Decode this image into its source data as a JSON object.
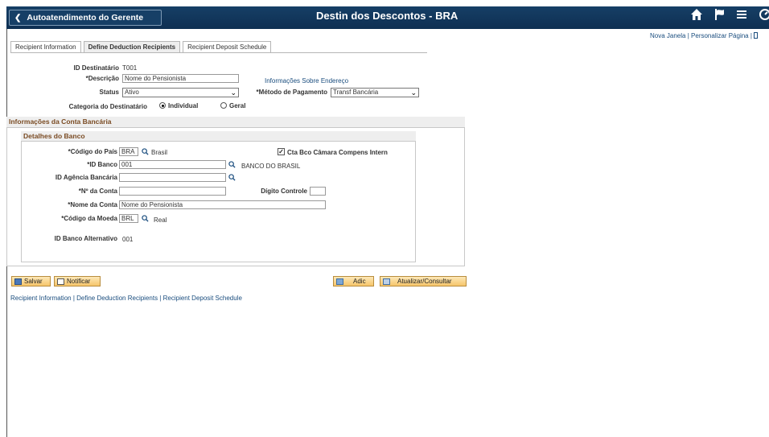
{
  "header": {
    "back_label": "Autoatendimento do Gerente",
    "title": "Destin dos Descontos - BRA",
    "icons": [
      "home-icon",
      "flag-icon",
      "menu-icon",
      "navbar-icon"
    ]
  },
  "top_links": {
    "new_window": "Nova Janela",
    "separator": "|",
    "personalize": "Personalizar Página",
    "separator2": "|"
  },
  "tabs": [
    {
      "label": "Recipient Information",
      "active": false
    },
    {
      "label": "Define Deduction Recipients",
      "active": true
    },
    {
      "label": "Recipient Deposit Schedule",
      "active": false
    }
  ],
  "form": {
    "id_label": "ID Destinatário",
    "id_value": "T001",
    "desc_label": "*Descrição",
    "desc_value": "Nome do Pensionista",
    "address_link": "Informações Sobre Endereço",
    "status_label": "Status",
    "status_value": "Ativo",
    "payment_label": "*Método de Pagamento",
    "payment_value": "Transf Bancária",
    "category_label": "Categoria do Destinatário",
    "category_individual": "Individual",
    "category_geral": "Geral",
    "category_selected": "Individual"
  },
  "bank_account_section": {
    "title": "Informações da Conta Bancária",
    "details_title": "Detalhes do Banco",
    "country_label": "*Código do País",
    "country_value": "BRA",
    "country_desc": "Brasil",
    "clearing_label": "Cta Bco Câmara Compens Intern",
    "clearing_checked": true,
    "bank_id_label": "*ID Banco",
    "bank_id_value": "001",
    "bank_name": "BANCO DO BRASIL",
    "agency_label": "ID Agência Bancária",
    "agency_value": "",
    "account_label": "*Nº da Conta",
    "account_value": "",
    "check_digit_label": "Dígito Controle",
    "check_digit_value": "",
    "account_name_label": "*Nome da Conta",
    "account_name_value": "Nome do Pensionista",
    "currency_label": "*Código da Moeda",
    "currency_value": "BRL",
    "currency_desc": "Real",
    "alt_bank_label": "ID Banco Alternativo",
    "alt_bank_value": "001"
  },
  "toolbar": {
    "save_label": "Salvar",
    "notify_label": "Notificar",
    "add_label": "Adic",
    "update_label": "Atualizar/Consultar"
  },
  "bottom_links": {
    "recipient_info": "Recipient Information",
    "sep1": " | ",
    "define_deduction": "Define Deduction Recipients",
    "sep2": " | ",
    "deposit_schedule": "Recipient Deposit Schedule"
  },
  "colors": {
    "header_bg": "#163f66",
    "link": "#1a4d7e",
    "section_title": "#7a4b23",
    "button_bg": "#f6c56a"
  }
}
